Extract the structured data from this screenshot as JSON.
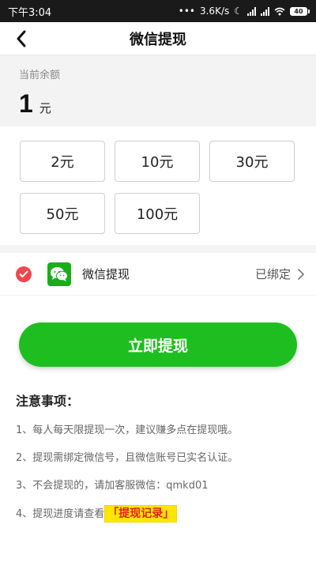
{
  "status_bar": {
    "time": "下午3:04",
    "dots": "•••",
    "network_speed": "3.6K/s",
    "battery": "40"
  },
  "nav": {
    "title": "微信提现"
  },
  "balance": {
    "label": "当前余额",
    "amount": "1",
    "unit": "元"
  },
  "amount_options": [
    "2元",
    "10元",
    "30元",
    "50元",
    "100元"
  ],
  "payment": {
    "method": "微信提现",
    "status": "已绑定"
  },
  "withdraw_button": "立即提现",
  "notes": {
    "title": "注意事项：",
    "items": [
      "1、每人每天限提现一次，建议赚多点在提现哦。",
      "2、提现需绑定微信号，且微信账号已实名认证。",
      "3、不会提现的，请加客服微信：qmkd01",
      "4、提现进度请查看"
    ],
    "link": "「提现记录」"
  },
  "colors": {
    "accent_green": "#1fbe20",
    "check_red": "#f0474f",
    "wechat_green": "#1aad19",
    "link_bg": "#ffe600",
    "link_text": "#e01e1e"
  }
}
